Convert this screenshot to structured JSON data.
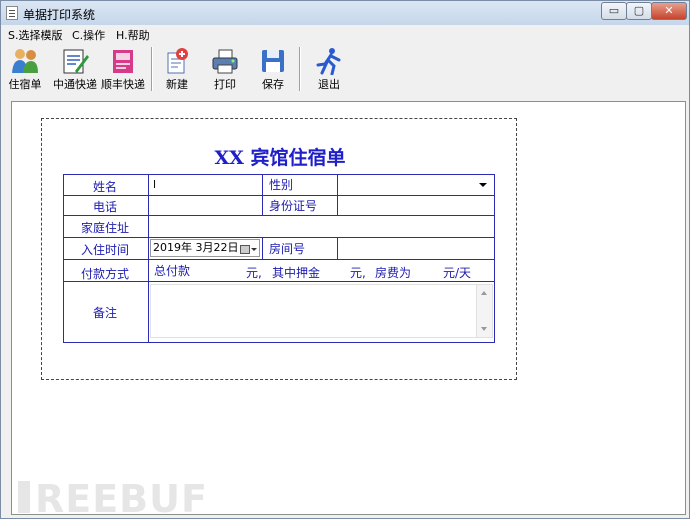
{
  "window": {
    "title": "单据打印系统",
    "controls": {
      "minimize": "▭",
      "maximize": "▢",
      "close": "✕"
    }
  },
  "menu": [
    {
      "label": "S.选择模版"
    },
    {
      "label": "C.操作"
    },
    {
      "label": "H.帮助"
    }
  ],
  "toolbar": [
    {
      "label": "住宿单",
      "icon": "people-icon"
    },
    {
      "label": "中通快递",
      "icon": "edit-document-icon"
    },
    {
      "label": "顺丰快递",
      "icon": "book-icon"
    },
    {
      "label": "新建",
      "icon": "new-document-icon"
    },
    {
      "label": "打印",
      "icon": "print-icon"
    },
    {
      "label": "保存",
      "icon": "save-disk-icon"
    },
    {
      "label": "退出",
      "icon": "running-man-icon"
    }
  ],
  "form": {
    "title": "XX 宾馆住宿单",
    "labels": {
      "name": "姓名",
      "gender": "性别",
      "phone": "电话",
      "id_number": "身份证号",
      "address": "家庭住址",
      "checkin_time": "入住时间",
      "room_number": "房间号",
      "payment": "付款方式",
      "total": "总付款",
      "yuan1": "元,",
      "deposit": "其中押金",
      "yuan2": "元,",
      "room_fee": "房费为",
      "per_day": "元/天",
      "remarks": "备注"
    },
    "values": {
      "name": "l",
      "gender": "",
      "phone": "",
      "id_number": "",
      "address": "",
      "checkin_date": "2019年 3月22日",
      "room_number": "",
      "total": "",
      "deposit": "",
      "room_fee": "",
      "remarks": ""
    }
  },
  "watermark": "REEBUF"
}
